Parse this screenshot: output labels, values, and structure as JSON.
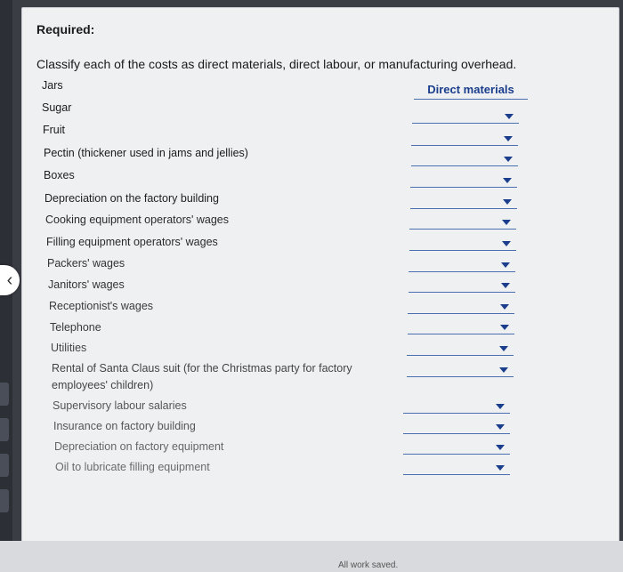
{
  "heading": "Required:",
  "instruction": "Classify each of the costs as direct materials, direct labour, or manufacturing overhead.",
  "column_header": "Direct materials",
  "items": [
    {
      "label": "Jars",
      "answer": ""
    },
    {
      "label": "Sugar",
      "answer": ""
    },
    {
      "label": "Fruit",
      "answer": ""
    },
    {
      "label": "Pectin (thickener used in jams and jellies)",
      "answer": ""
    },
    {
      "label": "Boxes",
      "answer": ""
    },
    {
      "label": "Depreciation on the factory building",
      "answer": ""
    },
    {
      "label": "Cooking equipment operators' wages",
      "answer": ""
    },
    {
      "label": "Filling equipment operators' wages",
      "answer": ""
    },
    {
      "label": "Packers' wages",
      "answer": ""
    },
    {
      "label": "Janitors' wages",
      "answer": ""
    },
    {
      "label": "Receptionist's wages",
      "answer": ""
    },
    {
      "label": "Telephone",
      "answer": ""
    },
    {
      "label": "Utilities",
      "answer": ""
    },
    {
      "label": "Rental of Santa Claus suit (for the Christmas party for factory",
      "label2": "employees' children)",
      "answer": ""
    },
    {
      "label": "Supervisory labour salaries",
      "answer": ""
    },
    {
      "label": "Insurance on factory building",
      "answer": ""
    },
    {
      "label": "Depreciation on factory equipment",
      "answer": ""
    },
    {
      "label": "Oil to lubricate filling equipment",
      "answer": ""
    }
  ],
  "status": "All work saved."
}
